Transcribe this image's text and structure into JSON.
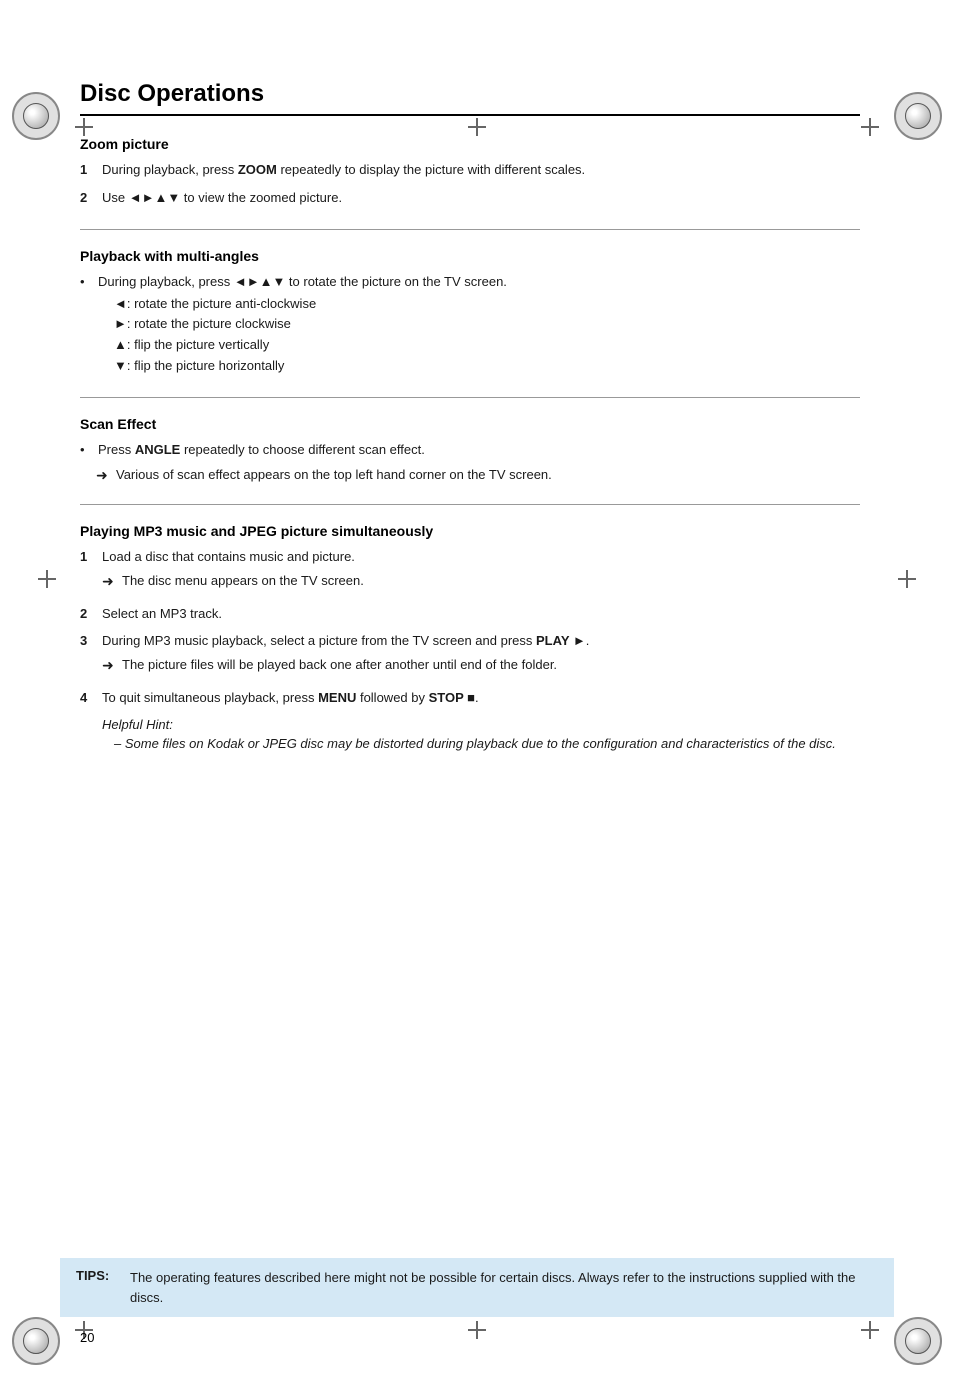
{
  "page": {
    "title": "Disc Operations",
    "page_number": "20"
  },
  "sections": [
    {
      "id": "zoom-picture",
      "title": "Zoom picture",
      "type": "numbered",
      "steps": [
        {
          "number": "1",
          "text": "During playback, press ",
          "bold_part": "ZOOM",
          "text_after": " repeatedly to display the picture with different scales."
        },
        {
          "number": "2",
          "text": "Use ◄►▲▼ to view the zoomed picture."
        }
      ]
    },
    {
      "id": "multi-angles",
      "title": "Playback with multi-angles",
      "type": "bullets",
      "items": [
        {
          "text": "During playback, press ◄►▲▼ to rotate the picture on the TV screen.",
          "sub_items": [
            "◄: rotate the picture anti-clockwise",
            "►: rotate the picture clockwise",
            "▲: flip the picture vertically",
            "▼: flip the picture horizontally"
          ]
        }
      ]
    },
    {
      "id": "scan-effect",
      "title": "Scan Effect",
      "type": "bullets",
      "items": [
        {
          "text_before": "Press ",
          "bold": "ANGLE",
          "text_after": " repeatedly to choose different scan effect."
        }
      ],
      "arrows": [
        "Various of scan effect appears on the top left hand corner on the TV screen."
      ]
    },
    {
      "id": "playing-mp3",
      "title": "Playing MP3 music and JPEG picture simultaneously",
      "type": "numbered",
      "steps": [
        {
          "number": "1",
          "text": "Load a disc that contains music and picture.",
          "arrow": "The disc menu appears on the TV screen."
        },
        {
          "number": "2",
          "text": "Select an MP3 track."
        },
        {
          "number": "3",
          "text_before": "During MP3 music playback, select a picture from the TV screen and press ",
          "bold": "PLAY ►",
          "text_after": ".",
          "arrow": "The picture files will be played back one after another until end of the folder."
        },
        {
          "number": "4",
          "text_before": "To quit simultaneous playback, press ",
          "bold1": "MENU",
          "text_mid": " followed by ",
          "bold2": "STOP ■",
          "text_after": "."
        }
      ],
      "helpful_hint": {
        "label": "Helpful Hint:",
        "items": [
          "Some files on Kodak or JPEG disc may be distorted during playback due to the configuration and characteristics of the disc."
        ]
      }
    }
  ],
  "tips": {
    "label": "TIPS:",
    "text": "The operating features described here might not be possible for certain discs. Always refer to the instructions supplied with the discs."
  }
}
